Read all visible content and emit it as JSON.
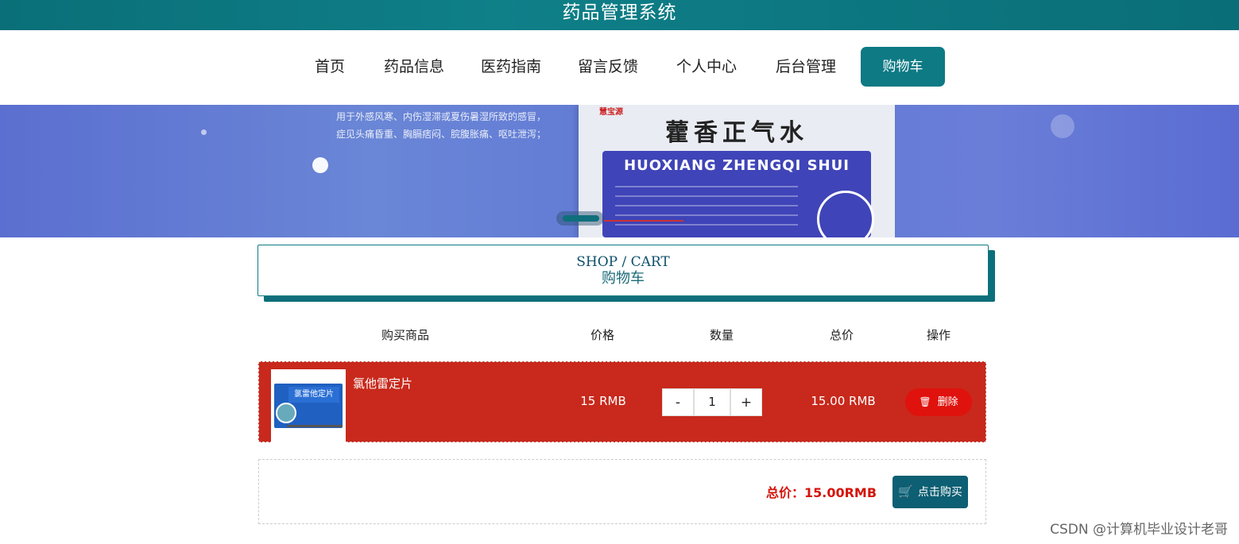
{
  "header": {
    "title": "药品管理系统"
  },
  "nav": {
    "items": [
      {
        "label": "首页"
      },
      {
        "label": "药品信息"
      },
      {
        "label": "医药指南"
      },
      {
        "label": "留言反馈"
      },
      {
        "label": "个人中心"
      },
      {
        "label": "后台管理"
      },
      {
        "label": "购物车"
      }
    ],
    "active_index": 6
  },
  "banner": {
    "text_lines": [
      "用于外感风寒、内伤湿滞或夏伤暑湿所致的感冒，",
      "症见头痛昏重、胸膈痞闷、脘腹胀痛、呕吐泄泻；"
    ],
    "product_cn": "藿香正气水",
    "product_pinyin": "HUOXIANG ZHENGQI SHUI",
    "brand": "慧宝源"
  },
  "shop_header": {
    "en": "SHOP / CART",
    "cn": "购物车"
  },
  "table": {
    "headers": [
      "购买商品",
      "价格",
      "数量",
      "总价",
      "操作"
    ]
  },
  "cart_items": [
    {
      "name": "氯他雷定片",
      "image_label": "氯雷他定片",
      "price": "15 RMB",
      "quantity": "1",
      "minus_label": "-",
      "plus_label": "+",
      "total": "15.00 RMB",
      "delete_label": "删除"
    }
  ],
  "checkout": {
    "total_label": "总价：15.00RMB",
    "buy_label": "点击购买"
  },
  "watermark": "CSDN @计算机毕业设计老哥",
  "colors": {
    "accent": "#0d7a84",
    "row_highlight": "#c8291c",
    "delete": "#e0120d",
    "total_text": "#d4140a"
  }
}
